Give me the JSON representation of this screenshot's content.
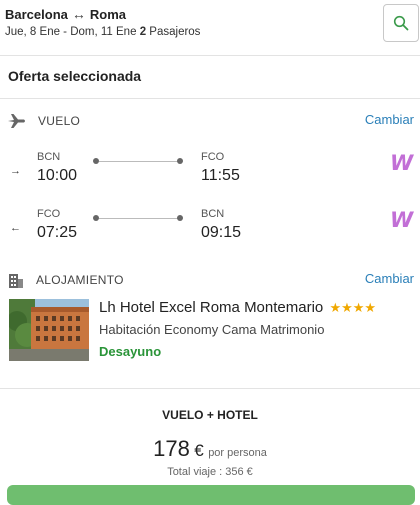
{
  "header": {
    "origin": "Barcelona",
    "destination": "Roma",
    "dates": "Jue, 8 Ene - Dom, 11 Ene",
    "passengers_count": "2",
    "passengers_label": "Pasajeros"
  },
  "offer": {
    "title": "Oferta seleccionada"
  },
  "flight": {
    "section_label": "VUELO",
    "change_label": "Cambiar",
    "outbound": {
      "from_code": "BCN",
      "from_time": "10:00",
      "to_code": "FCO",
      "to_time": "11:55",
      "airline_mark": "W"
    },
    "return": {
      "from_code": "FCO",
      "from_time": "07:25",
      "to_code": "BCN",
      "to_time": "09:15",
      "airline_mark": "W"
    }
  },
  "hotel": {
    "section_label": "ALOJAMIENTO",
    "change_label": "Cambiar",
    "name": "Lh Hotel Excel Roma Montemario",
    "stars": "★★★★",
    "room": "Habitación Economy Cama Matrimonio",
    "board": "Desayuno"
  },
  "pricing": {
    "package_label": "VUELO + HOTEL",
    "price": "178",
    "currency": "€",
    "per_person": "por persona",
    "total": "Total viaje : 356 €"
  },
  "colors": {
    "accent": "#2a7fb8",
    "board": "#2a9438",
    "stars": "#f0a800",
    "airline": "#c26fd6",
    "cta": "#6fbe6f"
  }
}
